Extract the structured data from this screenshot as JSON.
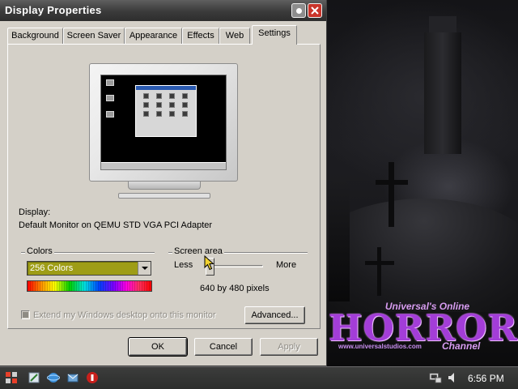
{
  "window": {
    "title": "Display Properties"
  },
  "tabs": [
    {
      "label": "Background"
    },
    {
      "label": "Screen Saver"
    },
    {
      "label": "Appearance"
    },
    {
      "label": "Effects"
    },
    {
      "label": "Web"
    },
    {
      "label": "Settings",
      "active": true
    }
  ],
  "display": {
    "heading": "Display:",
    "device": "Default Monitor on QEMU STD VGA PCI Adapter"
  },
  "colors": {
    "group_label": "Colors",
    "selected": "256 Colors"
  },
  "screen_area": {
    "group_label": "Screen area",
    "less_label": "Less",
    "more_label": "More",
    "resolution_text": "640 by 480 pixels",
    "slider_position": 0
  },
  "extend_desktop": {
    "label": "Extend my Windows desktop onto this monitor",
    "checked": true,
    "enabled": false
  },
  "buttons": {
    "advanced": "Advanced...",
    "ok": "OK",
    "cancel": "Cancel",
    "apply": "Apply"
  },
  "wallpaper": {
    "brand_top": "Universal's Online",
    "brand_main": "HORROR",
    "brand_url": "www.universalstudios.com",
    "brand_sub": "Channel"
  },
  "taskbar": {
    "icons": [
      "start-icon",
      "notepad-icon",
      "internet-explorer-icon",
      "outlook-express-icon",
      "media-player-icon"
    ],
    "clock": "6:56 PM"
  },
  "colors_theme": {
    "title_bar": "#3a3a3a",
    "dialog_face": "#d4d0c8",
    "selection": "#9e9d16",
    "close_button": "#c9342a"
  }
}
